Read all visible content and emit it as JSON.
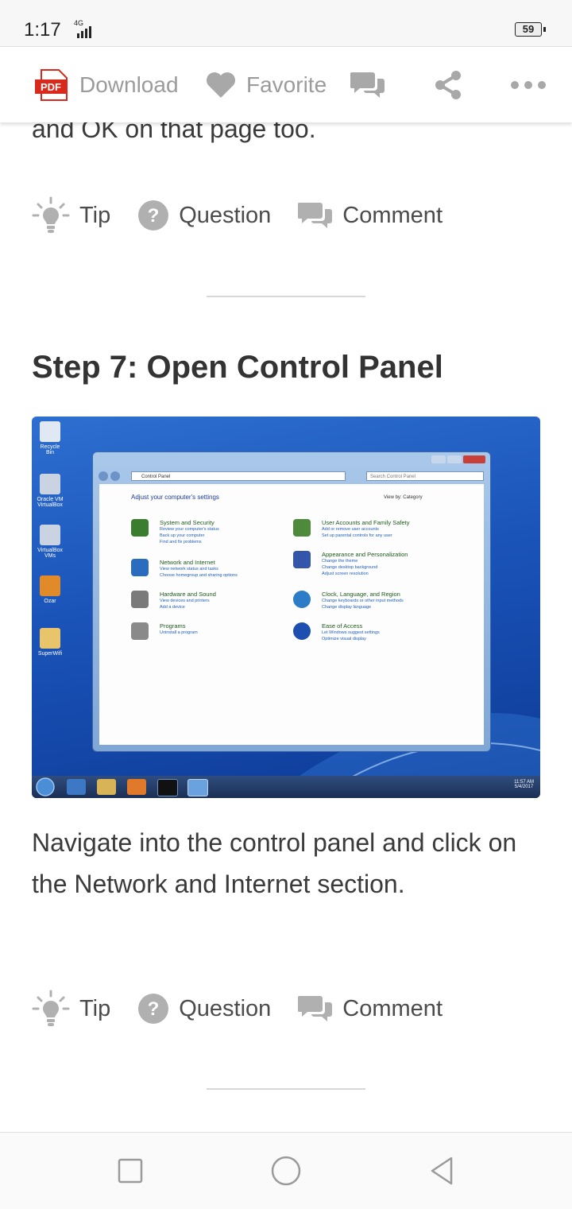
{
  "status_bar": {
    "time": "1:17",
    "network": "4G",
    "battery": "59"
  },
  "toolbar": {
    "pdf_badge": "PDF",
    "download_label": "Download",
    "favorite_label": "Favorite"
  },
  "previous_step": {
    "trailing_text": "and OK on that page too.",
    "actions": {
      "tip": "Tip",
      "question": "Question",
      "comment": "Comment"
    }
  },
  "step": {
    "title": "Step 7: Open Control Panel",
    "description": "Navigate into the control panel and click on the Network and Internet section.",
    "actions": {
      "tip": "Tip",
      "question": "Question",
      "comment": "Comment"
    },
    "screenshot": {
      "desktop_icons": [
        "Recycle Bin",
        "Oracle VM VirtualBox",
        "VirtualBox VMs",
        "Ozar",
        "SuperWifi"
      ],
      "address_bar": "Control Panel",
      "search_placeholder": "Search Control Panel",
      "heading": "Adjust your computer's settings",
      "view_by": "View by:  Category",
      "categories": [
        {
          "title": "System and Security",
          "links": [
            "Review your computer's status",
            "Back up your computer",
            "Find and fix problems"
          ],
          "color": "#3a7d2e"
        },
        {
          "title": "Network and Internet",
          "links": [
            "View network status and tasks",
            "Choose homegroup and sharing options"
          ],
          "color": "#2a6cc0"
        },
        {
          "title": "Hardware and Sound",
          "links": [
            "View devices and printers",
            "Add a device"
          ],
          "color": "#7a7a7a"
        },
        {
          "title": "Programs",
          "links": [
            "Uninstall a program"
          ],
          "color": "#8a8a8a"
        },
        {
          "title": "User Accounts and Family Safety",
          "links": [
            "Add or remove user accounts",
            "Set up parental controls for any user"
          ],
          "color": "#4d8a3c"
        },
        {
          "title": "Appearance and Personalization",
          "links": [
            "Change the theme",
            "Change desktop background",
            "Adjust screen resolution"
          ],
          "color": "#3355aa"
        },
        {
          "title": "Clock, Language, and Region",
          "links": [
            "Change keyboards or other input methods",
            "Change display language"
          ],
          "color": "#2d7cc8"
        },
        {
          "title": "Ease of Access",
          "links": [
            "Let Windows suggest settings",
            "Optimize visual display"
          ],
          "color": "#1d4fb0"
        }
      ],
      "tray_time": "11:57 AM",
      "tray_date": "5/4/2017"
    }
  },
  "colors": {
    "accent_pdf": "#d9291c",
    "icon_gray": "#a8a8a8",
    "text": "#3a3a3a"
  }
}
